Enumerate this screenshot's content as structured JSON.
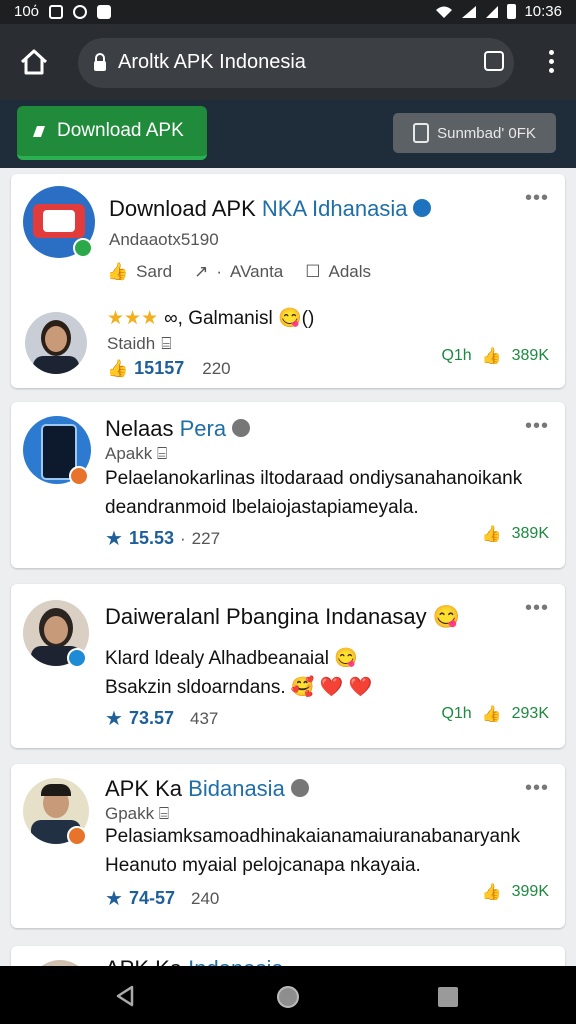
{
  "status_bar": {
    "time_left": "10ό",
    "time_right": "10:36"
  },
  "browser": {
    "url": "Aroltk APK Indonesia"
  },
  "toolbar": {
    "download_label": "Download APK",
    "secondary_label": "Sunmbad' 0FK"
  },
  "posts": [
    {
      "title": "Download APK",
      "title_blue": "NKA Idhanasia",
      "subtitle": "Andaaotx5190",
      "actions": [
        "Sard",
        "AVanta",
        "Adals"
      ],
      "comment_text": "∞, Galmanisl 😋()",
      "comment_user": "Staidh",
      "comment_rating": "15157",
      "comment_count": "220",
      "likes_prefix": "Q1h",
      "likes_count": "389K"
    },
    {
      "title": "Nelaas",
      "title_blue": "Pera",
      "subtitle": "Apakk",
      "text_lines": [
        "Pelaelanokarlinas iltodaraad ondiysanahanoikank",
        "deandranmoid lbelaiojastapiameyala."
      ],
      "rating": "15.53",
      "count": "227",
      "likes_count": "389K"
    },
    {
      "title": "Daiweralanl Pbangina Indanasay 😋",
      "text_lines": [
        "Klard ldealy Alhadbeanaial 😋",
        "Bsakzin sldoarndans. 🥰 ❤️ ❤️"
      ],
      "rating": "73.57",
      "count": "437",
      "likes_prefix": "Q1h",
      "likes_count": "293K"
    },
    {
      "title": "APK Ka",
      "title_blue": "Bidanasia",
      "subtitle": "Gpakk",
      "text_lines": [
        "Pelasiamksamoadhinakaianamaiuranabanaryank",
        "Heanuto myaial pelojcanapa nkayaia."
      ],
      "rating": "74-57",
      "count": "240",
      "likes_count": "399K"
    },
    {
      "title": "APK Ka",
      "title_blue": "Indanasia"
    }
  ],
  "colors": {
    "accent_green": "#1f8b3b",
    "link_blue": "#1e6ea8",
    "star": "#f2b01e"
  }
}
